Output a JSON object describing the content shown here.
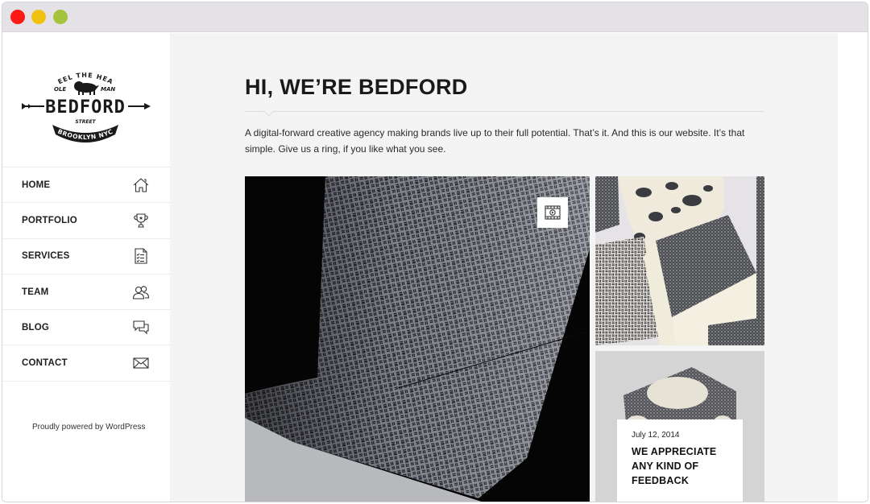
{
  "window": {
    "controls": [
      "close",
      "minimize",
      "maximize"
    ],
    "colors": {
      "close": "#fd1a16",
      "minimize": "#f1c110",
      "maximize": "#a3c43c"
    }
  },
  "logo": {
    "top_text": "FEEL THE HEAT",
    "left_small": "OLE",
    "right_small": "MAN",
    "name": "BEDFORD",
    "street": "STREET",
    "banner": "BROOKLYN NYC"
  },
  "nav": {
    "items": [
      {
        "label": "HOME",
        "icon": "home-icon"
      },
      {
        "label": "PORTFOLIO",
        "icon": "trophy-icon"
      },
      {
        "label": "SERVICES",
        "icon": "checklist-icon"
      },
      {
        "label": "TEAM",
        "icon": "team-icon"
      },
      {
        "label": "BLOG",
        "icon": "chat-bubbles-icon"
      },
      {
        "label": "CONTACT",
        "icon": "envelope-icon"
      }
    ]
  },
  "footer": {
    "powered": "Proudly powered by WordPress"
  },
  "main": {
    "title": "HI, WE’RE BEDFORD",
    "intro": "A digital-forward creative agency making brands live up to their full potential. That’s it. And this is our website. It’s that simple. Give us a ring, if you like what you see."
  },
  "tiles": {
    "big": {
      "badge_icon": "video-icon"
    },
    "bottom_right": {
      "date": "July 12, 2014",
      "title_lines": [
        "WE APPRECIATE",
        "ANY KIND OF",
        "FEEDBACK"
      ]
    }
  }
}
